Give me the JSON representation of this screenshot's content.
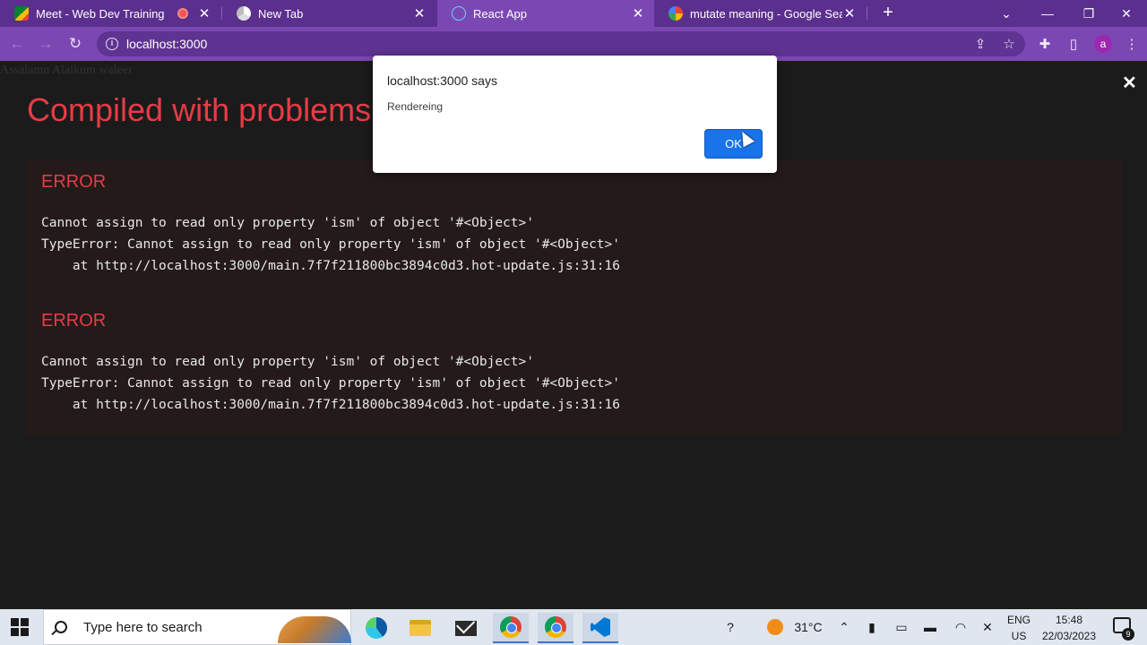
{
  "browser": {
    "tabs": [
      {
        "title": "Meet - Web Dev Training",
        "icon": "google-meet-icon",
        "recording": true,
        "active": false
      },
      {
        "title": "New Tab",
        "icon": "chrome-icon",
        "active": false
      },
      {
        "title": "React App",
        "icon": "react-icon",
        "active": true
      },
      {
        "title": "mutate meaning - Google Search",
        "icon": "google-icon",
        "active": false
      }
    ],
    "tab_close_glyph": "✕",
    "new_tab_glyph": "+",
    "window": {
      "dropdown": "⌄",
      "minimize": "—",
      "restore": "❐",
      "close": "✕"
    },
    "url": "localhost:3000",
    "avatar_initial": "a",
    "colors": {
      "frame": "#5b2f8e",
      "toolbar": "#7b48b3",
      "omnibox": "#5e3391"
    }
  },
  "page": {
    "behind_text": "Assalamu Alaikum waleer",
    "overlay_title": "Compiled with problems:",
    "overlay_close": "✕",
    "errors": [
      {
        "heading": "ERROR",
        "lines": "Cannot assign to read only property 'ism' of object '#<Object>'\nTypeError: Cannot assign to read only property 'ism' of object '#<Object>'\n    at http://localhost:3000/main.7f7f211800bc3894c0d3.hot-update.js:31:16"
      },
      {
        "heading": "ERROR",
        "lines": "Cannot assign to read only property 'ism' of object '#<Object>'\nTypeError: Cannot assign to read only property 'ism' of object '#<Object>'\n    at http://localhost:3000/main.7f7f211800bc3894c0d3.hot-update.js:31:16"
      }
    ],
    "colors": {
      "error_red": "#e83b46",
      "overlay_bg": "#1b1b1b"
    }
  },
  "alert": {
    "title": "localhost:3000 says",
    "message": "Rendereing",
    "ok_label": "OK",
    "ok_color": "#1a73e8"
  },
  "taskbar": {
    "search_placeholder": "Type here to search",
    "weather": "31°C",
    "language_top": "ENG",
    "language_bottom": "US",
    "time": "15:48",
    "date": "22/03/2023",
    "notification_count": "9",
    "apps": [
      "edge-icon",
      "file-explorer-icon",
      "mail-icon",
      "chrome-icon",
      "chrome-profile-icon",
      "vscode-icon"
    ]
  }
}
